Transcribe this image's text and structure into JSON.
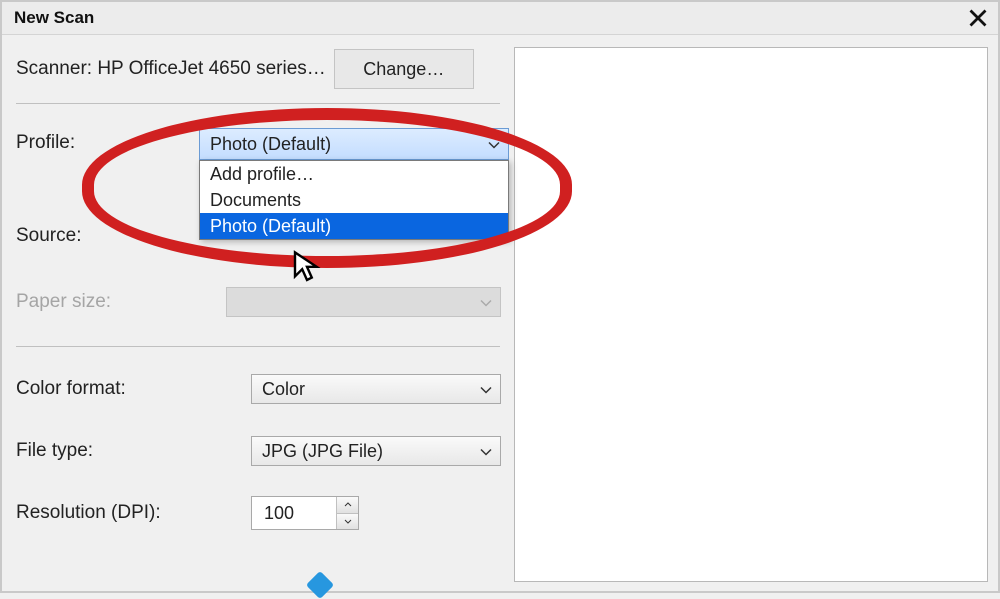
{
  "window": {
    "title": "New Scan"
  },
  "scanner": {
    "label": "Scanner:",
    "name": "HP OfficeJet 4650 series…",
    "change_button": "Change…"
  },
  "profile": {
    "label": "Profile:",
    "selected": "Photo (Default)",
    "options": [
      "Add profile…",
      "Documents",
      "Photo (Default)"
    ]
  },
  "source": {
    "label": "Source:",
    "selected": ""
  },
  "paper_size": {
    "label": "Paper size:",
    "selected": ""
  },
  "color_format": {
    "label": "Color format:",
    "selected": "Color"
  },
  "file_type": {
    "label": "File type:",
    "selected": "JPG (JPG File)"
  },
  "resolution": {
    "label": "Resolution (DPI):",
    "value": "100"
  }
}
